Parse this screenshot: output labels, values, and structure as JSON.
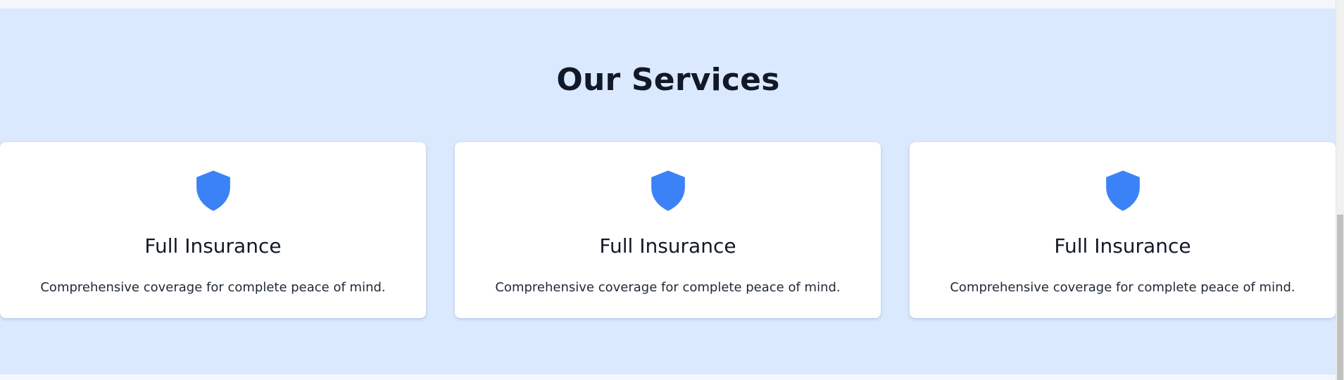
{
  "services_section": {
    "title": "Our Services",
    "background_color": "#dbe9fe",
    "cards": [
      {
        "icon": "shield-icon",
        "icon_color": "#3b82f6",
        "title": "Full Insurance",
        "description": "Comprehensive coverage for complete peace of mind."
      },
      {
        "icon": "shield-icon",
        "icon_color": "#3b82f6",
        "title": "Full Insurance",
        "description": "Comprehensive coverage for complete peace of mind."
      },
      {
        "icon": "shield-icon",
        "icon_color": "#3b82f6",
        "title": "Full Insurance",
        "description": "Comprehensive coverage for complete peace of mind."
      }
    ]
  }
}
